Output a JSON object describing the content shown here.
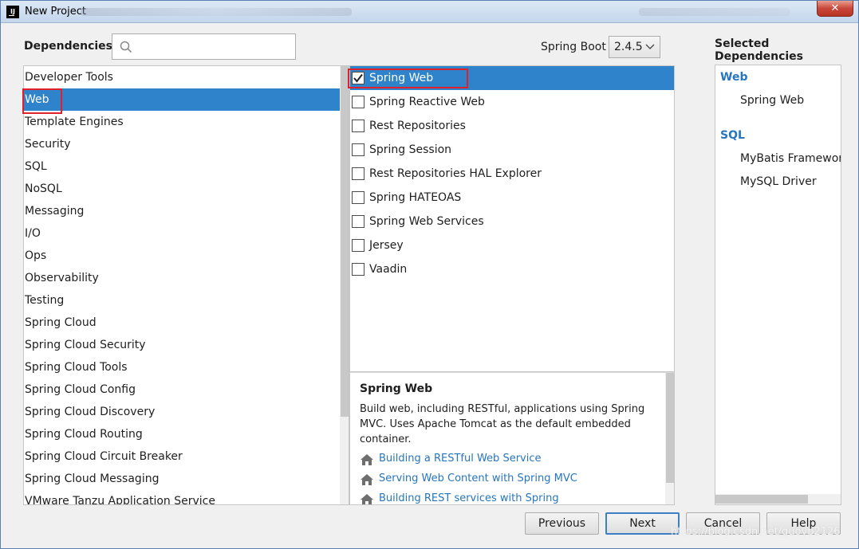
{
  "window": {
    "title": "New Project",
    "close_glyph": "✕",
    "app_icon_text": "IJ"
  },
  "header": {
    "dependencies_label": "Dependencies",
    "search_value": "",
    "search_placeholder": "",
    "spring_boot_label": "Spring Boot",
    "spring_boot_version": "2.4.5",
    "selected_dependencies_title": "Selected Dependencies"
  },
  "categories": [
    {
      "label": "Developer Tools",
      "selected": false
    },
    {
      "label": "Web",
      "selected": true
    },
    {
      "label": "Template Engines",
      "selected": false
    },
    {
      "label": "Security",
      "selected": false
    },
    {
      "label": "SQL",
      "selected": false
    },
    {
      "label": "NoSQL",
      "selected": false
    },
    {
      "label": "Messaging",
      "selected": false
    },
    {
      "label": "I/O",
      "selected": false
    },
    {
      "label": "Ops",
      "selected": false
    },
    {
      "label": "Observability",
      "selected": false
    },
    {
      "label": "Testing",
      "selected": false
    },
    {
      "label": "Spring Cloud",
      "selected": false
    },
    {
      "label": "Spring Cloud Security",
      "selected": false
    },
    {
      "label": "Spring Cloud Tools",
      "selected": false
    },
    {
      "label": "Spring Cloud Config",
      "selected": false
    },
    {
      "label": "Spring Cloud Discovery",
      "selected": false
    },
    {
      "label": "Spring Cloud Routing",
      "selected": false
    },
    {
      "label": "Spring Cloud Circuit Breaker",
      "selected": false
    },
    {
      "label": "Spring Cloud Messaging",
      "selected": false
    },
    {
      "label": "VMware Tanzu Application Service",
      "selected": false
    }
  ],
  "dependencies": [
    {
      "label": "Spring Web",
      "checked": true,
      "selected": true
    },
    {
      "label": "Spring Reactive Web",
      "checked": false,
      "selected": false
    },
    {
      "label": "Rest Repositories",
      "checked": false,
      "selected": false
    },
    {
      "label": "Spring Session",
      "checked": false,
      "selected": false
    },
    {
      "label": "Rest Repositories HAL Explorer",
      "checked": false,
      "selected": false
    },
    {
      "label": "Spring HATEOAS",
      "checked": false,
      "selected": false
    },
    {
      "label": "Spring Web Services",
      "checked": false,
      "selected": false
    },
    {
      "label": "Jersey",
      "checked": false,
      "selected": false
    },
    {
      "label": "Vaadin",
      "checked": false,
      "selected": false
    }
  ],
  "description": {
    "title": "Spring Web",
    "body": "Build web, including RESTful, applications using Spring MVC. Uses Apache Tomcat as the default embedded container.",
    "links": [
      {
        "label": "Building a RESTful Web Service",
        "icon": "home-icon"
      },
      {
        "label": "Serving Web Content with Spring MVC",
        "icon": "home-icon"
      },
      {
        "label": "Building REST services with Spring",
        "icon": "home-icon"
      }
    ]
  },
  "selected_dependencies": [
    {
      "group": "Web",
      "items": [
        "Spring Web"
      ]
    },
    {
      "group": "SQL",
      "items": [
        "MyBatis Framework",
        "MySQL Driver"
      ]
    }
  ],
  "buttons": {
    "previous": "Previous",
    "next": "Next",
    "cancel": "Cancel",
    "help": "Help"
  },
  "watermark": "https://blog.csdn.net/guoyp2126",
  "colors": {
    "selection": "#2e83cb",
    "link": "#2675bf",
    "highlight_box": "#e0202a"
  }
}
